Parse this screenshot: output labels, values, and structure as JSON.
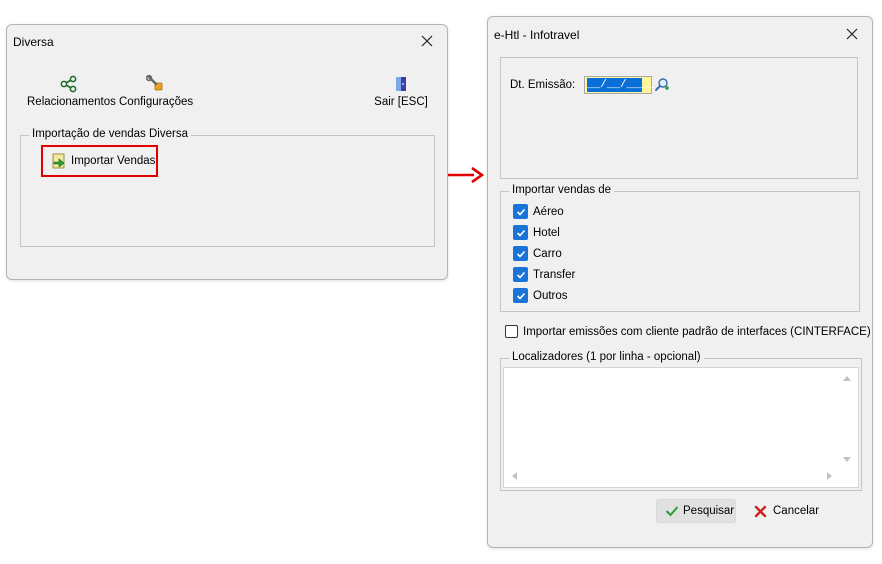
{
  "left_window": {
    "title": "Diversa",
    "toolbar": {
      "relacionamentos": "Relacionamentos",
      "configuracoes": "Configurações",
      "sair": "Sair [ESC]"
    },
    "group_label": "Importação de vendas Diversa",
    "import_button": "Importar Vendas"
  },
  "right_window": {
    "title": "e-Htl - Infotravel",
    "dt_emissao_label": "Dt. Emissão:",
    "dt_emissao_value": "__/__/____",
    "importar_group_label": "Importar vendas de",
    "checkboxes": [
      {
        "label": "Aéreo",
        "checked": true
      },
      {
        "label": "Hotel",
        "checked": true
      },
      {
        "label": "Carro",
        "checked": true
      },
      {
        "label": "Transfer",
        "checked": true
      },
      {
        "label": "Outros",
        "checked": true
      }
    ],
    "cinterface_label": "Importar emissões com cliente padrão de interfaces (CINTERFACE)",
    "cinterface_checked": false,
    "localizadores_label": "Localizadores (1 por linha - opcional)",
    "localizadores_value": "",
    "pesquisar": "Pesquisar",
    "cancelar": "Cancelar"
  },
  "colors": {
    "highlight_red": "#e00000",
    "checkbox_blue": "#1a73d9",
    "date_field_blue": "#0a6fd8"
  }
}
